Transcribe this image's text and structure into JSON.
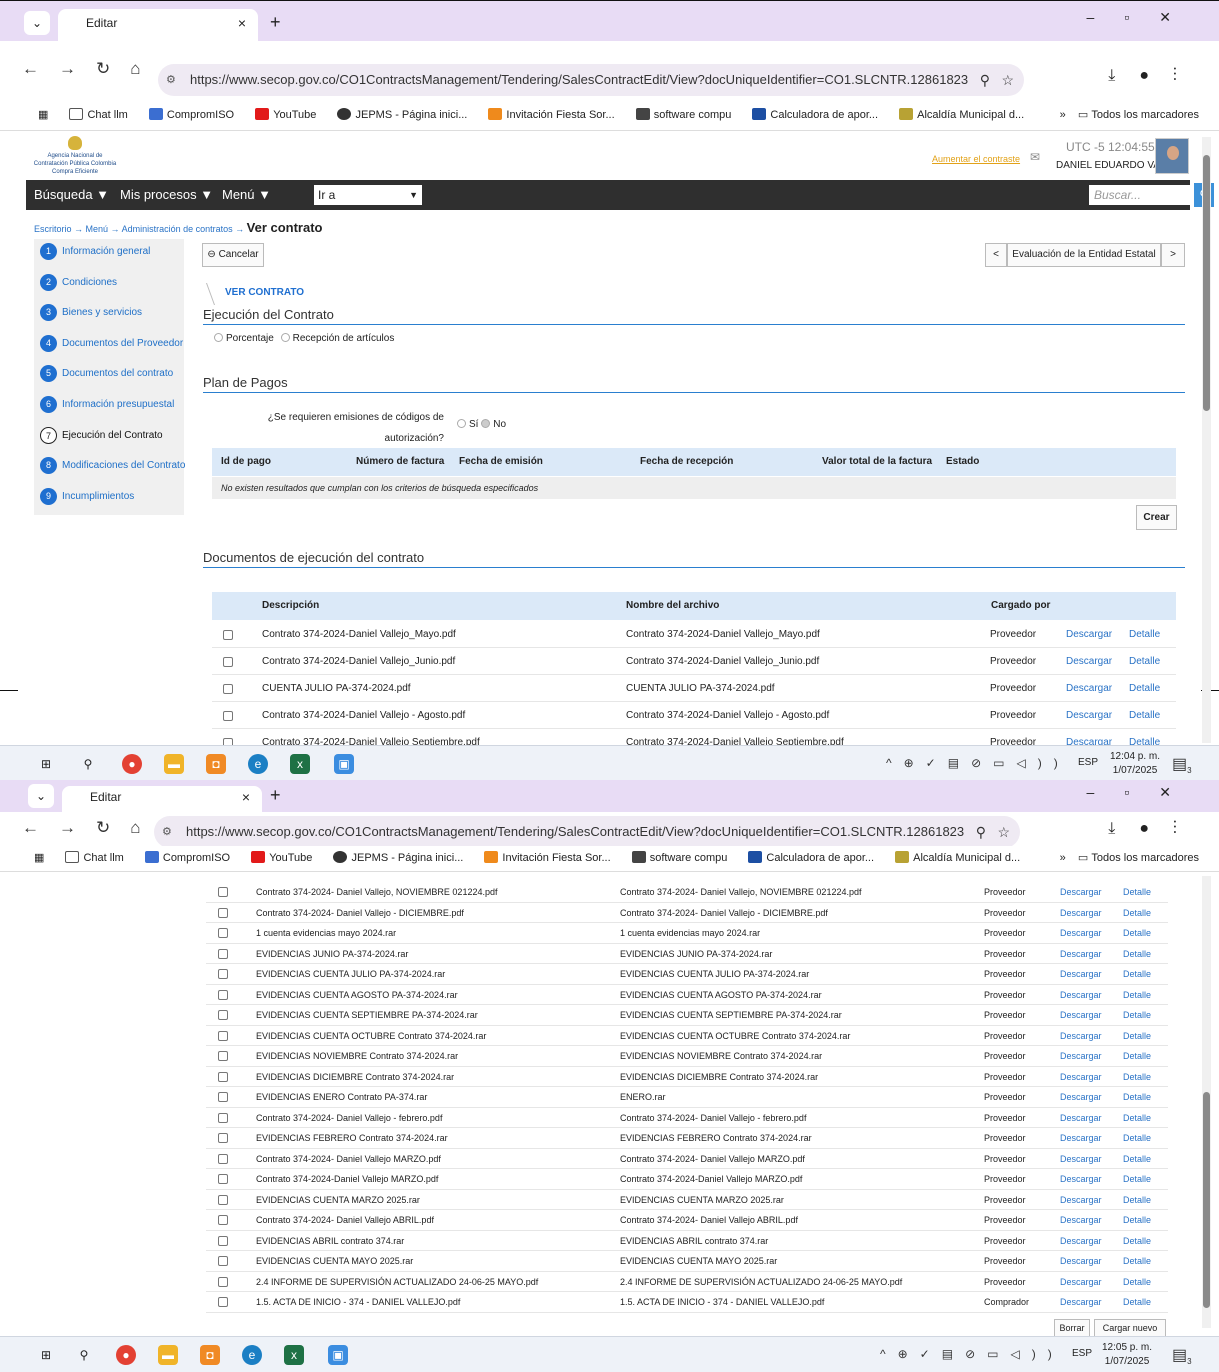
{
  "browser": {
    "tab_title": "Editar",
    "tab_close": "×",
    "new_tab": "+",
    "url": "https://www.secop.gov.co/CO1ContractsManagement/Tendering/SalesContractEdit/View?docUniqueIdentifier=CO1.SLCNTR.12861823",
    "bookmarks": [
      "Chat llm",
      "CompromISO",
      "YouTube",
      "JEPMS - Página inici...",
      "Invitación Fiesta Sor...",
      "software compu",
      "Calculadora de apor...",
      "Alcaldía Municipal d..."
    ],
    "all_bookmarks": "Todos los marcadores"
  },
  "header": {
    "logo_text": "Agencia Nacional de Contratación Pública Colombia Compra Eficiente",
    "contrast_link": "Aumentar el contraste",
    "time_1": "UTC -5 12:04:55",
    "user_name": "DANIEL EDUARDO VA..."
  },
  "menu": {
    "busqueda": "Búsqueda ▼",
    "procesos": "Mis procesos ▼",
    "menu": "Menú ▼",
    "goto": "Ir a",
    "search_placeholder": "Buscar..."
  },
  "breadcrumb": {
    "escritorio": "Escritorio",
    "menu": "Menú",
    "admin": "Administración de contratos",
    "current": "Ver contrato"
  },
  "sidebar": [
    {
      "num": "1",
      "label": "Información general"
    },
    {
      "num": "2",
      "label": "Condiciones"
    },
    {
      "num": "3",
      "label": "Bienes y servicios"
    },
    {
      "num": "4",
      "label": "Documentos del Proveedor"
    },
    {
      "num": "5",
      "label": "Documentos del contrato"
    },
    {
      "num": "6",
      "label": "Información presupuestal"
    },
    {
      "num": "7",
      "label": "Ejecución del Contrato"
    },
    {
      "num": "8",
      "label": "Modificaciones del Contrato"
    },
    {
      "num": "9",
      "label": "Incumplimientos"
    }
  ],
  "main": {
    "cancel": "Cancelar",
    "eval_prev": "<",
    "eval_label": "Evaluación de la Entidad Estatal",
    "eval_next": ">",
    "ver_contrato": "VER CONTRATO",
    "ejecucion_title": "Ejecución del Contrato",
    "opt_porcentaje": "Porcentaje",
    "opt_recepcion": "Recepción de artículos",
    "plan_title": "Plan de Pagos",
    "question_1": "¿Se requieren emisiones de códigos de",
    "question_2": "autorización?",
    "opt_si": "Sí",
    "opt_no": "No",
    "pay_headers": [
      "Id de pago",
      "Número de factura",
      "Fecha de emisión",
      "Fecha de recepción",
      "Valor total de la factura",
      "Estado"
    ],
    "no_results": "No existen resultados que cumplan con los criterios de búsqueda especificados",
    "crear": "Crear",
    "docs_title": "Documentos de ejecución del contrato",
    "doc_headers": [
      "Descripción",
      "Nombre del archivo",
      "Cargado por"
    ],
    "descargar": "Descargar",
    "detalle": "Detalle"
  },
  "docs_top": [
    {
      "desc": "Contrato 374-2024-Daniel Vallejo_Mayo.pdf",
      "file": "Contrato 374-2024-Daniel Vallejo_Mayo.pdf",
      "by": "Proveedor"
    },
    {
      "desc": "Contrato 374-2024-Daniel Vallejo_Junio.pdf",
      "file": "Contrato 374-2024-Daniel Vallejo_Junio.pdf",
      "by": "Proveedor"
    },
    {
      "desc": "CUENTA JULIO PA-374-2024.pdf",
      "file": "CUENTA JULIO PA-374-2024.pdf",
      "by": "Proveedor"
    },
    {
      "desc": "Contrato 374-2024-Daniel Vallejo - Agosto.pdf",
      "file": "Contrato 374-2024-Daniel Vallejo - Agosto.pdf",
      "by": "Proveedor"
    },
    {
      "desc": "Contrato 374-2024-Daniel Vallejo Septiembre.pdf",
      "file": "Contrato 374-2024-Daniel Vallejo Septiembre.pdf",
      "by": "Proveedor"
    }
  ],
  "docs_bottom": [
    {
      "desc": "Contrato 374-2024- Daniel Vallejo, NOVIEMBRE 021224.pdf",
      "file": "Contrato 374-2024- Daniel Vallejo, NOVIEMBRE 021224.pdf",
      "by": "Proveedor"
    },
    {
      "desc": "Contrato 374-2024- Daniel Vallejo - DICIEMBRE.pdf",
      "file": "Contrato 374-2024- Daniel Vallejo - DICIEMBRE.pdf",
      "by": "Proveedor"
    },
    {
      "desc": "1 cuenta evidencias mayo 2024.rar",
      "file": "1 cuenta evidencias mayo 2024.rar",
      "by": "Proveedor"
    },
    {
      "desc": "EVIDENCIAS JUNIO PA-374-2024.rar",
      "file": "EVIDENCIAS JUNIO PA-374-2024.rar",
      "by": "Proveedor"
    },
    {
      "desc": "EVIDENCIAS CUENTA JULIO PA-374-2024.rar",
      "file": "EVIDENCIAS CUENTA JULIO PA-374-2024.rar",
      "by": "Proveedor"
    },
    {
      "desc": "EVIDENCIAS CUENTA AGOSTO PA-374-2024.rar",
      "file": "EVIDENCIAS CUENTA AGOSTO PA-374-2024.rar",
      "by": "Proveedor"
    },
    {
      "desc": "EVIDENCIAS CUENTA SEPTIEMBRE PA-374-2024.rar",
      "file": "EVIDENCIAS CUENTA SEPTIEMBRE PA-374-2024.rar",
      "by": "Proveedor"
    },
    {
      "desc": "EVIDENCIAS CUENTA OCTUBRE Contrato 374-2024.rar",
      "file": "EVIDENCIAS CUENTA OCTUBRE Contrato 374-2024.rar",
      "by": "Proveedor"
    },
    {
      "desc": "EVIDENCIAS NOVIEMBRE Contrato 374-2024.rar",
      "file": "EVIDENCIAS NOVIEMBRE Contrato 374-2024.rar",
      "by": "Proveedor"
    },
    {
      "desc": "EVIDENCIAS DICIEMBRE Contrato 374-2024.rar",
      "file": "EVIDENCIAS DICIEMBRE Contrato 374-2024.rar",
      "by": "Proveedor"
    },
    {
      "desc": "EVIDENCIAS ENERO Contrato PA-374.rar",
      "file": "ENERO.rar",
      "by": "Proveedor"
    },
    {
      "desc": "Contrato 374-2024- Daniel Vallejo - febrero.pdf",
      "file": "Contrato 374-2024- Daniel Vallejo - febrero.pdf",
      "by": "Proveedor"
    },
    {
      "desc": "EVIDENCIAS FEBRERO Contrato 374-2024.rar",
      "file": "EVIDENCIAS FEBRERO Contrato 374-2024.rar",
      "by": "Proveedor"
    },
    {
      "desc": "Contrato 374-2024- Daniel Vallejo MARZO.pdf",
      "file": "Contrato 374-2024- Daniel Vallejo MARZO.pdf",
      "by": "Proveedor"
    },
    {
      "desc": "Contrato 374-2024-Daniel Vallejo MARZO.pdf",
      "file": "Contrato 374-2024-Daniel Vallejo MARZO.pdf",
      "by": "Proveedor"
    },
    {
      "desc": "EVIDENCIAS CUENTA MARZO 2025.rar",
      "file": "EVIDENCIAS CUENTA MARZO 2025.rar",
      "by": "Proveedor"
    },
    {
      "desc": "Contrato 374-2024- Daniel Vallejo ABRIL.pdf",
      "file": "Contrato 374-2024- Daniel Vallejo ABRIL.pdf",
      "by": "Proveedor"
    },
    {
      "desc": "EVIDENCIAS ABRIL contrato 374.rar",
      "file": "EVIDENCIAS ABRIL contrato 374.rar",
      "by": "Proveedor"
    },
    {
      "desc": "EVIDENCIAS CUENTA MAYO 2025.rar",
      "file": "EVIDENCIAS CUENTA MAYO 2025.rar",
      "by": "Proveedor"
    },
    {
      "desc": "2.4 INFORME DE SUPERVISIÓN ACTUALIZADO 24-06-25 MAYO.pdf",
      "file": "2.4 INFORME DE SUPERVISIÓN ACTUALIZADO 24-06-25 MAYO.pdf",
      "by": "Proveedor"
    },
    {
      "desc": "1.5. ACTA DE INICIO - 374 - DANIEL VALLEJO.pdf",
      "file": "1.5. ACTA DE INICIO - 374 - DANIEL VALLEJO.pdf",
      "by": "Comprador"
    }
  ],
  "footer_buttons": {
    "borrar": "Borrar",
    "cargar": "Cargar nuevo"
  },
  "taskbar": {
    "lang": "ESP",
    "time_1": "12:04 p. m.",
    "date_1": "1/07/2025",
    "time_2": "12:05 p. m.",
    "date_2": "1/07/2025",
    "notif_count": "3"
  },
  "colors": {
    "accent": "#1f6fd0",
    "link": "#2a73c6",
    "menubar": "#2f2f2f",
    "tab_bg": "#e8dcf5",
    "table_head": "#dbe9f8"
  }
}
